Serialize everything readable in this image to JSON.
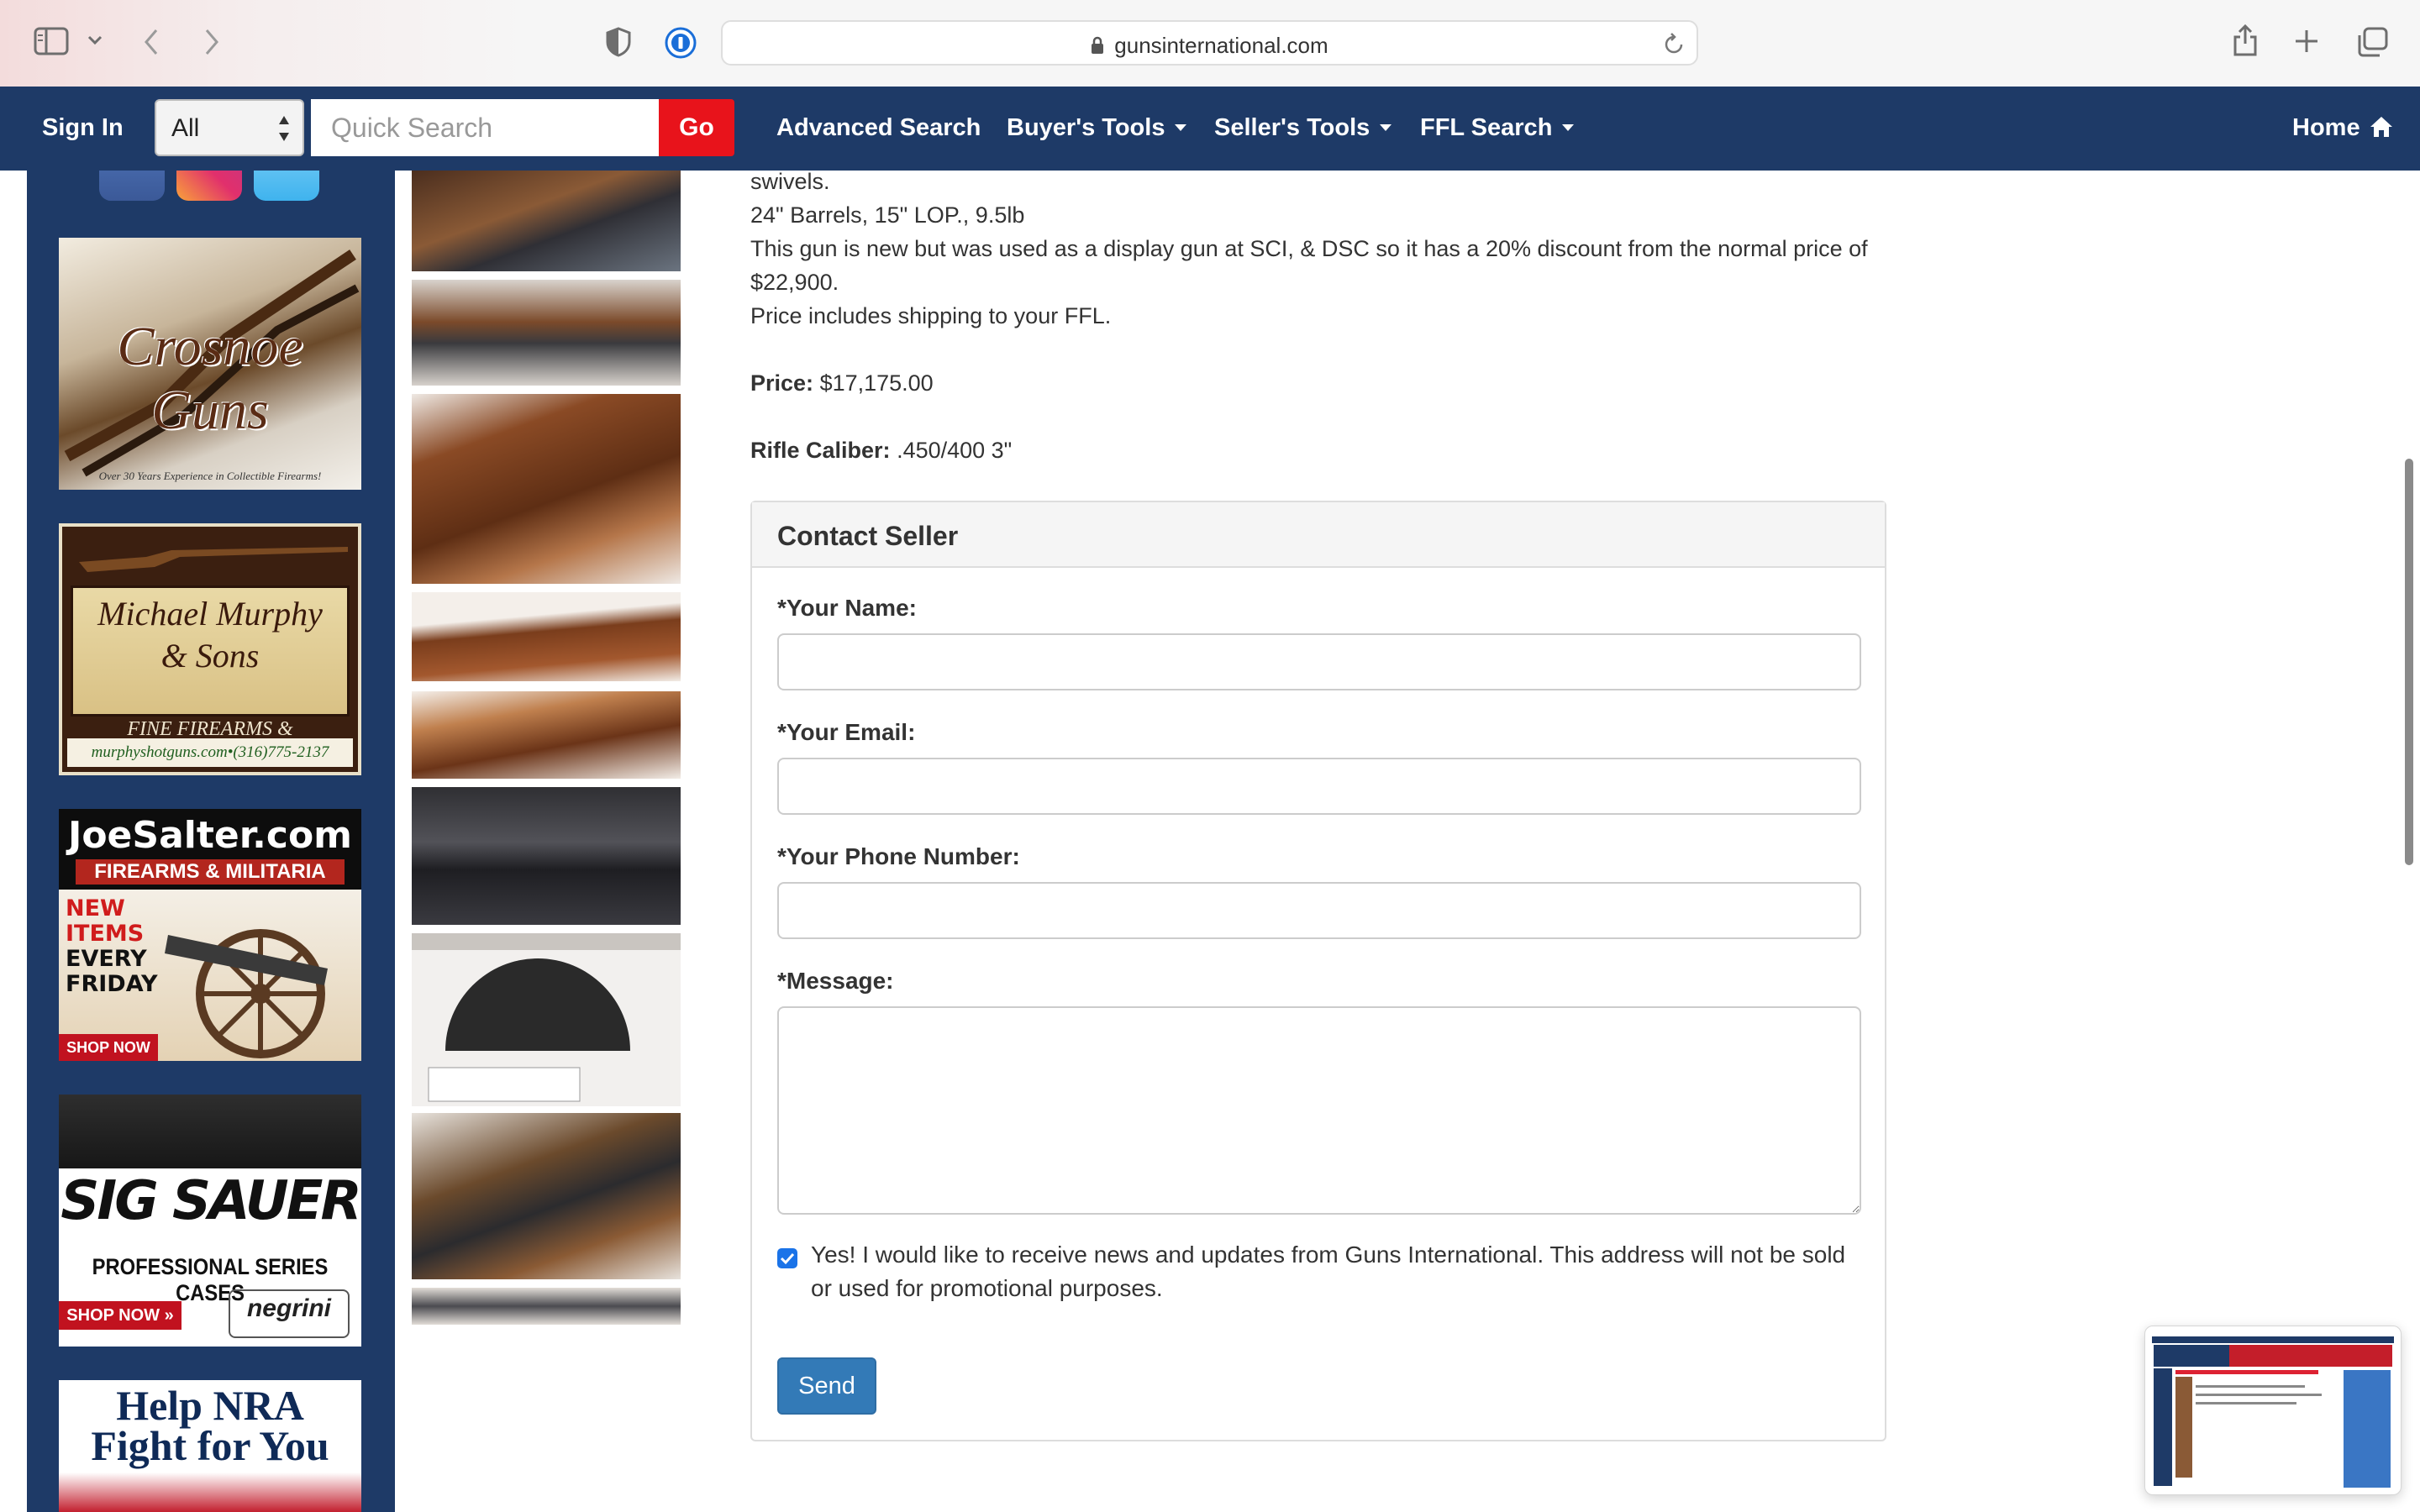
{
  "browser": {
    "url": "gunsinternational.com"
  },
  "nav": {
    "sign_in": "Sign In",
    "category_value": "All",
    "search_placeholder": "Quick Search",
    "go_label": "Go",
    "advanced_search": "Advanced Search",
    "buyers_tools": "Buyer's Tools",
    "sellers_tools": "Seller's Tools",
    "ffl_search": "FFL Search",
    "home": "Home"
  },
  "ads": {
    "crosnoe": {
      "title": "Crosnoe Guns",
      "sub": "Over 30 Years Experience in Collectible Firearms!"
    },
    "murphy": {
      "name_line1": "Michael Murphy",
      "name_line2": "& Sons",
      "tagline": "FINE FIREARMS & ACCESSORIES",
      "phone": "murphyshotguns.com•(316)775-2137"
    },
    "salter": {
      "title": "JoeSalter.com",
      "sub": "FIREARMS & MILITARIA",
      "new1": "NEW",
      "new2": "ITEMS",
      "new3": "EVERY",
      "new4": "FRIDAY",
      "shop": "SHOP NOW"
    },
    "sig": {
      "logo": "SIG SAUER",
      "sub": "PROFESSIONAL SERIES CASES",
      "shop": "SHOP NOW »",
      "brand": "negrini"
    },
    "nra": {
      "line1": "Help NRA",
      "line2": "Fight for You"
    }
  },
  "listing": {
    "desc_line1": "swivels.",
    "desc_line2": "24\" Barrels, 15\" LOP., 9.5lb",
    "desc_line3": "This gun is new but was used as a display gun at SCI, & DSC so it has a 20% discount from the normal price of $22,900.",
    "desc_line4": "Price includes shipping to your FFL.",
    "price_label": "Price:",
    "price_value": "$17,175.00",
    "caliber_label": "Rifle Caliber:",
    "caliber_value": ".450/400 3\""
  },
  "contact": {
    "title": "Contact Seller",
    "name_label": "*Your Name:",
    "email_label": "*Your Email:",
    "phone_label": "*Your Phone Number:",
    "message_label": "*Message:",
    "name_value": "",
    "email_value": "",
    "phone_value": "",
    "message_value": "",
    "newsletter_checked": true,
    "newsletter_text": "Yes! I would like to receive news and updates from Guns International. This address will not be sold or used for promotional purposes.",
    "send_label": "Send"
  },
  "colors": {
    "nav_bg": "#1e3a67",
    "go_red": "#e8131b",
    "send_blue": "#337ab7"
  }
}
